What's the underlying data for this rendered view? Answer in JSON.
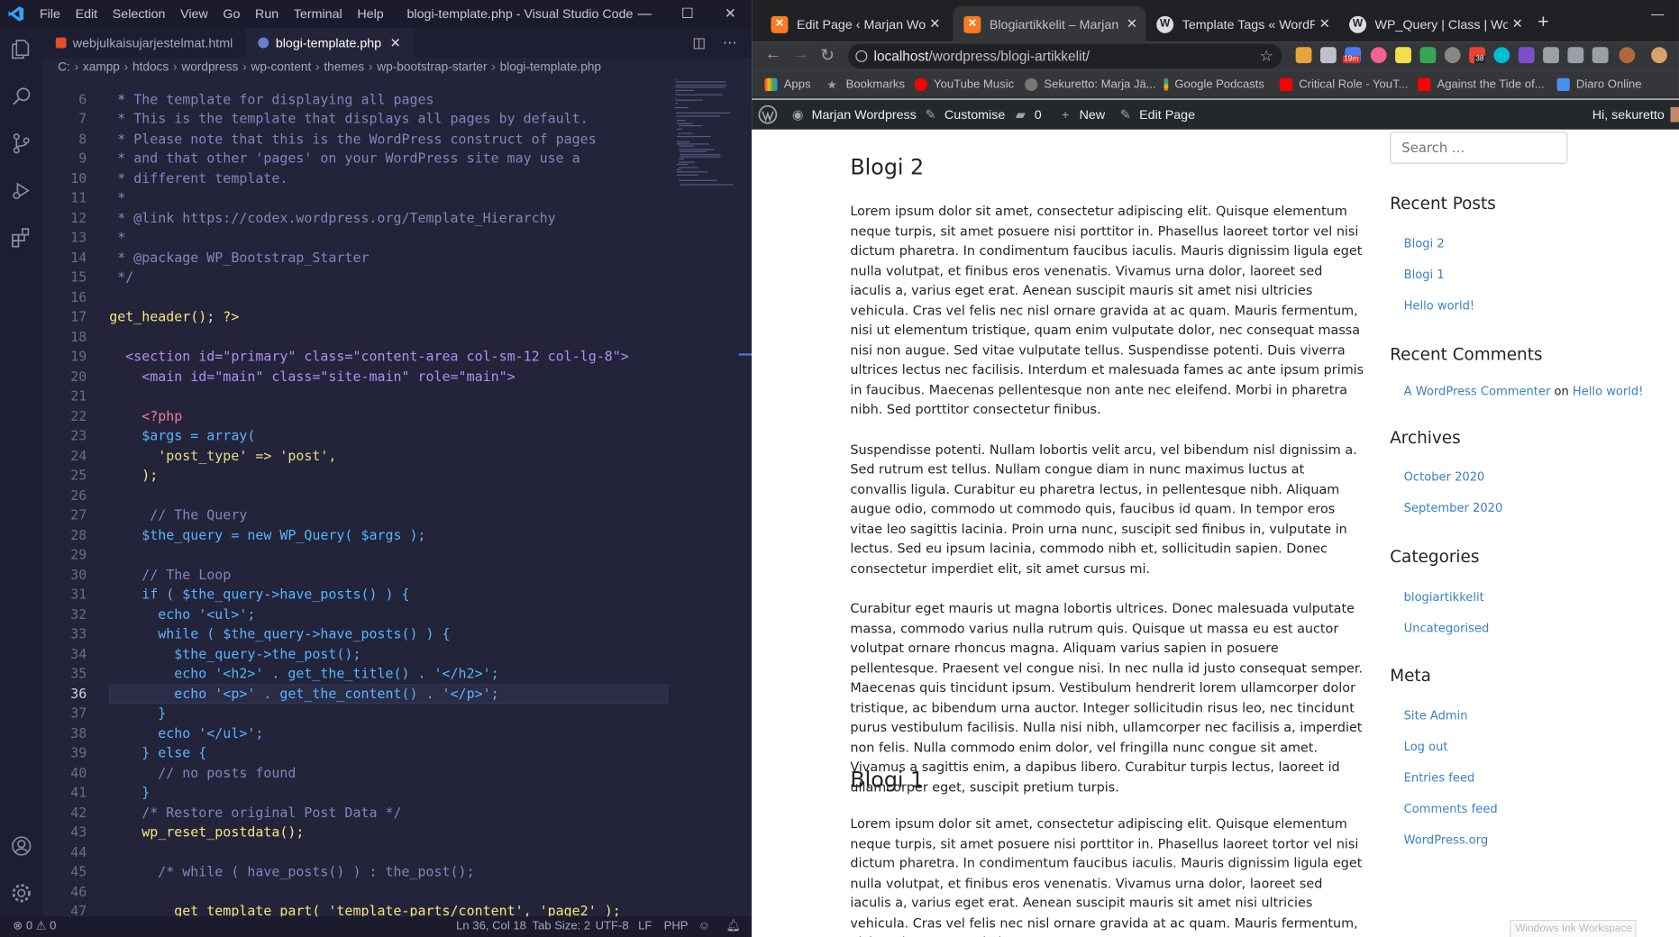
{
  "vscode": {
    "window_title": "blogi-template.php - Visual Studio Code",
    "menu": [
      "File",
      "Edit",
      "Selection",
      "View",
      "Go",
      "Run",
      "Terminal",
      "Help"
    ],
    "window_controls": [
      "—",
      "☐",
      "✕"
    ],
    "tabs": [
      {
        "label": "webjulkaisujarjestelmat.html",
        "active": false
      },
      {
        "label": "blogi-template.php",
        "active": true
      }
    ],
    "breadcrumb": [
      "C:",
      "xampp",
      "htdocs",
      "wordpress",
      "wp-content",
      "themes",
      "wp-bootstrap-starter",
      "blogi-template.php"
    ],
    "partial_top_line": " * The template for displaying all pages",
    "code_lines": [
      {
        "n": "6",
        "text": " *"
      },
      {
        "n": "7",
        "text": " * This is the template that displays all pages by default."
      },
      {
        "n": "8",
        "text": " * Please note that this is the WordPress construct of pages"
      },
      {
        "n": "9",
        "text": " * and that other 'pages' on your WordPress site may use a"
      },
      {
        "n": "10",
        "text": " * different template."
      },
      {
        "n": "11",
        "text": " *"
      },
      {
        "n": "12",
        "text": " * @link https://codex.wordpress.org/Template_Hierarchy"
      },
      {
        "n": "13",
        "text": " *"
      },
      {
        "n": "14",
        "text": " * @package WP_Bootstrap_Starter"
      },
      {
        "n": "15",
        "text": " */"
      },
      {
        "n": "16",
        "text": ""
      },
      {
        "n": "17",
        "text": "get_header(); ?>"
      },
      {
        "n": "18",
        "text": ""
      },
      {
        "n": "19",
        "text": "  <section id=\"primary\" class=\"content-area col-sm-12 col-lg-8\">"
      },
      {
        "n": "20",
        "text": "    <main id=\"main\" class=\"site-main\" role=\"main\">"
      },
      {
        "n": "21",
        "text": ""
      },
      {
        "n": "22",
        "text": "    <?php"
      },
      {
        "n": "23",
        "text": "    $args = array("
      },
      {
        "n": "24",
        "text": "      'post_type' => 'post',"
      },
      {
        "n": "25",
        "text": "    );"
      },
      {
        "n": "26",
        "text": ""
      },
      {
        "n": "27",
        "text": "     // The Query"
      },
      {
        "n": "28",
        "text": "    $the_query = new WP_Query( $args );"
      },
      {
        "n": "29",
        "text": ""
      },
      {
        "n": "30",
        "text": "    // The Loop"
      },
      {
        "n": "31",
        "text": "    if ( $the_query->have_posts() ) {"
      },
      {
        "n": "32",
        "text": "      echo '<ul>';"
      },
      {
        "n": "33",
        "text": "      while ( $the_query->have_posts() ) {"
      },
      {
        "n": "34",
        "text": "        $the_query->the_post();"
      },
      {
        "n": "35",
        "text": "        echo '<h2>' . get_the_title() . '</h2>';"
      },
      {
        "n": "36",
        "text": "        echo '<p>' . get_the_content() . '</p>';"
      },
      {
        "n": "37",
        "text": "      }"
      },
      {
        "n": "38",
        "text": "      echo '</ul>';"
      },
      {
        "n": "39",
        "text": "    } else {"
      },
      {
        "n": "40",
        "text": "      // no posts found"
      },
      {
        "n": "41",
        "text": "    }"
      },
      {
        "n": "42",
        "text": "    /* Restore original Post Data */"
      },
      {
        "n": "43",
        "text": "    wp_reset_postdata();"
      },
      {
        "n": "44",
        "text": ""
      },
      {
        "n": "45",
        "text": "      /* while ( have_posts() ) : the_post();"
      },
      {
        "n": "46",
        "text": ""
      },
      {
        "n": "47",
        "text": "        get_template_part( 'template-parts/content', 'page2' );"
      }
    ],
    "current_line": "36",
    "status": {
      "problems": "⊗ 0 ⚠ 0",
      "position": "Ln 36, Col 18",
      "tab_size": "Tab Size: 2",
      "encoding": "UTF-8",
      "eol": "LF",
      "language": "PHP"
    }
  },
  "chrome": {
    "tabs": [
      {
        "title": "Edit Page ‹ Marjan Wordpress",
        "icon": "xampp-icon",
        "active": false
      },
      {
        "title": "Blogiartikkelit – Marjan Wordpress",
        "icon": "xampp-icon",
        "active": true
      },
      {
        "title": "Template Tags « WordPress Codex",
        "icon": "wordpress-icon",
        "active": false
      },
      {
        "title": "WP_Query | Class | WordPress Developer",
        "icon": "wordpress-icon",
        "active": false
      }
    ],
    "url_host": "localhost",
    "url_path": "/wordpress/blogi-artikkelit/",
    "bookmarks": [
      "Apps",
      "Bookmarks",
      "YouTube Music",
      "Sekuretto: Marja Jä...",
      "Google Podcasts",
      "Critical Role - YouT...",
      "Against the Tide of...",
      "Diaro Online"
    ],
    "ext_badges": {
      "calendar": "19m",
      "mail": "38"
    }
  },
  "wp_admin_bar": {
    "site_name": "Marjan Wordpress",
    "customise": "Customise",
    "comments_count": "0",
    "new": "New",
    "edit_page": "Edit Page",
    "greeting": "Hi, sekuretto"
  },
  "posts": [
    {
      "title": "Blogi 2",
      "paragraphs": [
        "Lorem ipsum dolor sit amet, consectetur adipiscing elit. Quisque elementum neque turpis, sit amet posuere nisi porttitor in. Phasellus laoreet tortor vel nisi dictum pharetra. In condimentum faucibus iaculis. Mauris dignissim ligula eget nulla volutpat, et finibus eros venenatis. Vivamus urna dolor, laoreet sed iaculis a, varius eget erat. Aenean suscipit mauris sit amet nisi ultricies vehicula. Cras vel felis nec nisl ornare gravida at ac quam. Mauris fermentum, nisi ut elementum tristique, quam enim vulputate dolor, nec consequat massa nisi non augue. Sed vitae vulputate tellus. Suspendisse potenti. Duis viverra ultrices lectus nec facilisis. Interdum et malesuada fames ac ante ipsum primis in faucibus. Maecenas pellentesque non ante nec eleifend. Morbi in pharetra nibh. Sed porttitor consectetur finibus.",
        "Suspendisse potenti. Nullam lobortis velit arcu, vel bibendum nisl dignissim a. Sed rutrum est tellus. Nullam congue diam in nunc maximus luctus at convallis ligula. Curabitur eu pharetra lectus, in pellentesque nibh. Aliquam augue odio, commodo ut commodo quis, faucibus id quam. In tempor eros vitae leo sagittis lacinia. Proin urna nunc, suscipit sed finibus in, vulputate in lectus. Sed eu ipsum lacinia, commodo nibh et, sollicitudin sapien. Donec consectetur imperdiet elit, sit amet cursus mi.",
        "Curabitur eget mauris ut magna lobortis ultrices. Donec malesuada vulputate massa, commodo varius nulla rutrum quis. Quisque ut massa eu est auctor volutpat ornare rhoncus magna. Aliquam varius sapien in posuere pellentesque. Praesent vel congue nisi. In nec nulla id justo consequat semper. Maecenas quis tincidunt ipsum. Vestibulum hendrerit lorem ullamcorper dolor tristique, ac bibendum urna auctor. Integer sollicitudin risus leo, nec tincidunt purus vestibulum facilisis. Nulla nisi nibh, ullamcorper nec facilisis a, imperdiet non felis. Nulla commodo enim dolor, vel fringilla nunc congue sit amet. Vivamus a sagittis enim, a dapibus libero. Curabitur turpis lectus, laoreet id ullamcorper eget, suscipit pretium turpis."
      ]
    },
    {
      "title": "Blogi 1",
      "paragraphs": [
        "Lorem ipsum dolor sit amet, consectetur adipiscing elit. Quisque elementum neque turpis, sit amet posuere nisi porttitor in. Phasellus laoreet tortor vel nisi dictum pharetra. In condimentum faucibus iaculis. Mauris dignissim ligula eget nulla volutpat, et finibus eros venenatis. Vivamus urna dolor, laoreet sed iaculis a, varius eget erat. Aenean suscipit mauris sit amet nisi ultricies vehicula. Cras vel felis nec nisl ornare gravida at ac quam. Mauris fermentum, nisi ut elementum tristique, quam"
      ]
    }
  ],
  "sidebar": {
    "search_placeholder": "Search ...",
    "recent_posts_title": "Recent Posts",
    "recent_posts": [
      "Blogi 2",
      "Blogi 1",
      "Hello world!"
    ],
    "recent_comments_title": "Recent Comments",
    "recent_comment": {
      "author": "A WordPress Commenter",
      "on": "on",
      "post": "Hello world!"
    },
    "archives_title": "Archives",
    "archives": [
      "October 2020",
      "September 2020"
    ],
    "categories_title": "Categories",
    "categories": [
      "blogiartikkelit",
      "Uncategorised"
    ],
    "meta_title": "Meta",
    "meta": [
      "Site Admin",
      "Log out",
      "Entries feed",
      "Comments feed",
      "WordPress.org"
    ]
  },
  "overlay": {
    "ink_workspace": "Windows Ink Workspace"
  },
  "colors": {
    "vscode_bg": "#23233a",
    "wp_link": "#3a80c8",
    "adminbar": "#23282d",
    "chrome_dark": "#202124"
  }
}
